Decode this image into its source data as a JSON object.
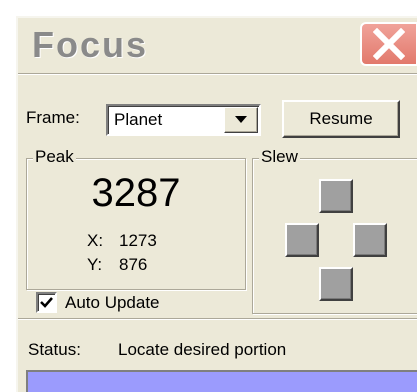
{
  "window": {
    "title": "Focus",
    "close_icon": "close-x-icon"
  },
  "frame": {
    "label": "Frame:",
    "selected": "Planet",
    "dropdown_icon": "chevron-down-icon"
  },
  "resume_button": {
    "label": "Resume"
  },
  "peak": {
    "group_label": "Peak",
    "value": "3287",
    "x_label": "X:",
    "x_value": "1273",
    "y_label": "Y:",
    "y_value": "876"
  },
  "auto_update": {
    "label": "Auto Update",
    "checked": true
  },
  "slew": {
    "group_label": "Slew",
    "buttons": [
      "up",
      "left",
      "right",
      "down"
    ]
  },
  "status": {
    "label": "Status:",
    "text": "Locate desired portion"
  },
  "colors": {
    "window_bg": "#ece9d8",
    "close_button": "#e2796c",
    "status_bar": "#9b9bfd"
  }
}
